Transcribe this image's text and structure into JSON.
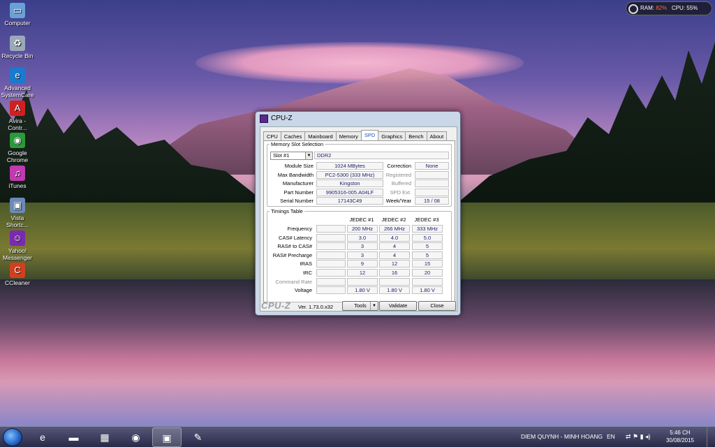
{
  "desktop": {
    "icons": [
      {
        "label": "Computer",
        "icon": "computer-icon",
        "glyph": "▭",
        "color": "#6aa0d8"
      },
      {
        "label": "Recycle Bin",
        "icon": "recycle-bin-icon",
        "glyph": "♻",
        "color": "#9aa8b8"
      },
      {
        "label": "Advanced SystemCare",
        "icon": "advanced-systemcare-icon",
        "glyph": "e",
        "color": "#1a7ad0"
      },
      {
        "label": "Avira - Contr...",
        "icon": "avira-icon",
        "glyph": "A",
        "color": "#d02020"
      },
      {
        "label": "Google Chrome",
        "icon": "chrome-icon",
        "glyph": "◉",
        "color": "#2a9a3a"
      },
      {
        "label": "iTunes",
        "icon": "itunes-icon",
        "glyph": "♫",
        "color": "#c03ab0"
      },
      {
        "label": "Vista Shortc...",
        "icon": "vista-shortcut-icon",
        "glyph": "▣",
        "color": "#6a8ab8"
      },
      {
        "label": "Yahoo! Messenger",
        "icon": "yahoo-messenger-icon",
        "glyph": "☺",
        "color": "#7a2ab0"
      },
      {
        "label": "CCleaner",
        "icon": "ccleaner-icon",
        "glyph": "C",
        "color": "#d04020"
      }
    ]
  },
  "widget": {
    "ram_label": "RAM:",
    "ram_value": "82%",
    "cpu_label": "CPU:",
    "cpu_value": "55%"
  },
  "cpuz": {
    "title": "CPU-Z",
    "tabs": [
      "CPU",
      "Caches",
      "Mainboard",
      "Memory",
      "SPD",
      "Graphics",
      "Bench",
      "About"
    ],
    "active_tab": "SPD",
    "slot_section": {
      "legend": "Memory Slot Selection",
      "slot_selected": "Slot #1",
      "memory_type": "DDR2",
      "rows": [
        {
          "label": "Module Size",
          "value": "1024 MBytes",
          "r_label": "Correction",
          "r_value": "None",
          "r_gray": false
        },
        {
          "label": "Max Bandwidth",
          "value": "PC2-5300 (333 MHz)",
          "r_label": "Registered",
          "r_value": "",
          "r_gray": true
        },
        {
          "label": "Manufacturer",
          "value": "Kingston",
          "r_label": "Buffered",
          "r_value": "",
          "r_gray": true
        },
        {
          "label": "Part Number",
          "value": "9905316-005.A04LF",
          "r_label": "SPD Ext.",
          "r_value": "",
          "r_gray": true
        },
        {
          "label": "Serial Number",
          "value": "17143C49",
          "r_label": "Week/Year",
          "r_value": "15 / 08",
          "r_gray": false
        }
      ]
    },
    "timings": {
      "legend": "Timings Table",
      "columns": [
        "JEDEC #1",
        "JEDEC #2",
        "JEDEC #3"
      ],
      "rows": [
        {
          "label": "Frequency",
          "values": [
            "200 MHz",
            "266 MHz",
            "333 MHz"
          ],
          "gray": false
        },
        {
          "label": "CAS# Latency",
          "values": [
            "3.0",
            "4.0",
            "5.0"
          ],
          "gray": false
        },
        {
          "label": "RAS# to CAS#",
          "values": [
            "3",
            "4",
            "5"
          ],
          "gray": false
        },
        {
          "label": "RAS# Precharge",
          "values": [
            "3",
            "4",
            "5"
          ],
          "gray": false
        },
        {
          "label": "tRAS",
          "values": [
            "9",
            "12",
            "15"
          ],
          "gray": false
        },
        {
          "label": "tRC",
          "values": [
            "12",
            "16",
            "20"
          ],
          "gray": false
        },
        {
          "label": "Command Rate",
          "values": [
            "",
            "",
            ""
          ],
          "gray": true
        },
        {
          "label": "Voltage",
          "values": [
            "1.80 V",
            "1.80 V",
            "1.80 V"
          ],
          "gray": false
        }
      ]
    },
    "footer": {
      "logo": "CPU-Z",
      "version": "Ver. 1.73.0.x32",
      "tools_label": "Tools",
      "validate_label": "Validate",
      "close_label": "Close"
    }
  },
  "taskbar": {
    "apps": [
      {
        "name": "internet-explorer",
        "icon": "ie-icon",
        "glyph": "e",
        "active": false
      },
      {
        "name": "file-explorer",
        "icon": "folder-icon",
        "glyph": "▬",
        "active": false
      },
      {
        "name": "calculator",
        "icon": "calculator-icon",
        "glyph": "▦",
        "active": false
      },
      {
        "name": "windows-media",
        "icon": "media-player-icon",
        "glyph": "◉",
        "active": false
      },
      {
        "name": "cpu-z",
        "icon": "cpuz-icon",
        "glyph": "▣",
        "active": true
      },
      {
        "name": "paint",
        "icon": "paint-icon",
        "glyph": "✎",
        "active": false
      }
    ],
    "now_playing": "DIEM QUYNH - MINH HOANG",
    "language": "EN",
    "time": "5:46 CH",
    "date": "30/08/2015"
  }
}
